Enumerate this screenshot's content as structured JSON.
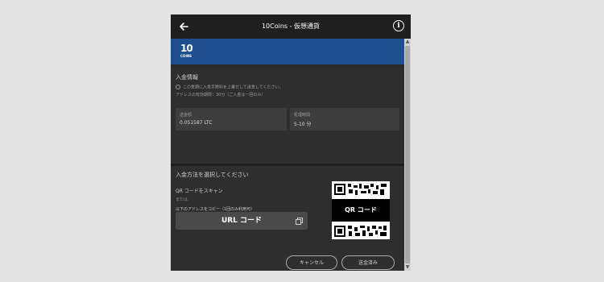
{
  "window": {
    "title": "10Coins - 仮想通貨"
  },
  "icons": {
    "back": "arrow-left-icon",
    "info": "info-icon",
    "copy": "copy-icon"
  },
  "brand": {
    "logo_mark": "10",
    "logo_text": "COINS",
    "banner_color": "#1d4f8f"
  },
  "deposit_info": {
    "title": "入金情報",
    "notice": "この金額に入金手数料を上乗せして送金してください。",
    "address_note": "アドレスの有効期限：30分（ご入金は一回のみ）",
    "amount_label": "送金額",
    "amount_value": "0.051587 LTC",
    "time_label": "処理時間",
    "time_value": "5-10 分"
  },
  "method": {
    "title": "入金方法を選択してください",
    "qr_scan": "QR コードをスキャン",
    "or": "または",
    "address_copy": "以下のアドレスをコピー（1回のみ利用可）",
    "url_button": "URL コード",
    "qr_label": "QR コード"
  },
  "actions": {
    "cancel": "キャンセル",
    "done": "送金済み"
  }
}
